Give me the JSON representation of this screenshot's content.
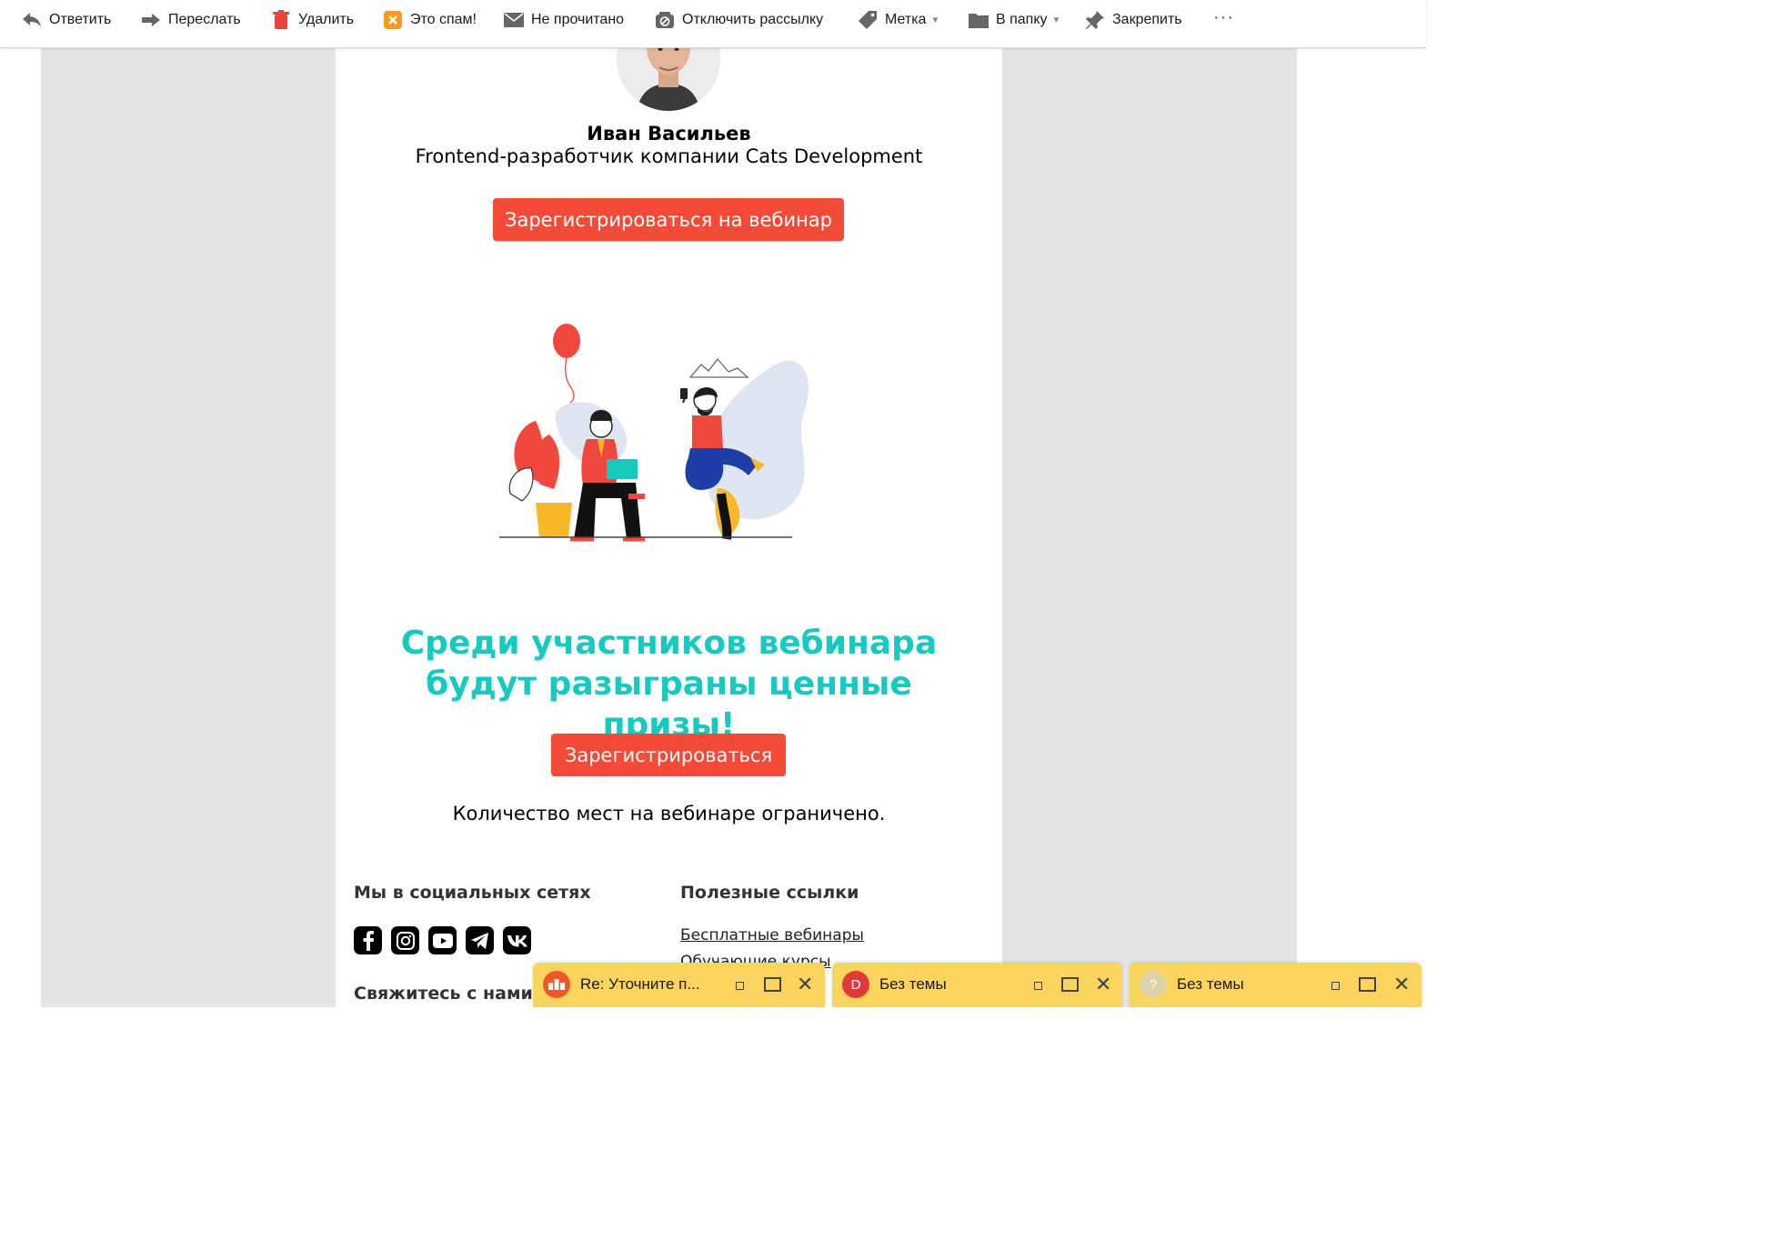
{
  "toolbar": {
    "reply": "Ответить",
    "forward": "Переслать",
    "delete": "Удалить",
    "spam": "Это спам!",
    "unread": "Не прочитано",
    "unsubscribe": "Отключить рассылку",
    "label": "Метка",
    "to_folder": "В папку",
    "pin": "Закрепить",
    "more": "···"
  },
  "email": {
    "speaker_name": "Иван Васильев",
    "speaker_role": "Frontend-разработчик компании Cats Development",
    "register_webinar_button": "Зарегистрироваться на вебинар",
    "prize_heading": "Среди участников вебинара будут разыграны ценные призы!",
    "register_button": "Зарегистрироваться",
    "limited_seats": "Количество мест на вебинаре ограничено.",
    "footer": {
      "social_heading": "Мы в социальных сетях",
      "useful_links_heading": "Полезные ссылки",
      "links": [
        "Бесплатные вебинары",
        "Обучающие курсы"
      ],
      "contact_heading": "Свяжитесь с нами",
      "social_icons": [
        "facebook-icon",
        "instagram-icon",
        "youtube-icon",
        "telegram-icon",
        "vk-icon"
      ]
    }
  },
  "tabs": [
    {
      "title": "Re: Уточните п...",
      "avatar_letter": "",
      "avatar_color": "#f0582a"
    },
    {
      "title": "Без темы",
      "avatar_letter": "D",
      "avatar_color": "#e03a3a"
    },
    {
      "title": "Без темы",
      "avatar_letter": "?",
      "avatar_color": "#dcd3a8"
    }
  ],
  "colors": {
    "accent_red": "#f44a38",
    "accent_teal": "#18c9c0",
    "tab_yellow": "#fbd45d"
  }
}
